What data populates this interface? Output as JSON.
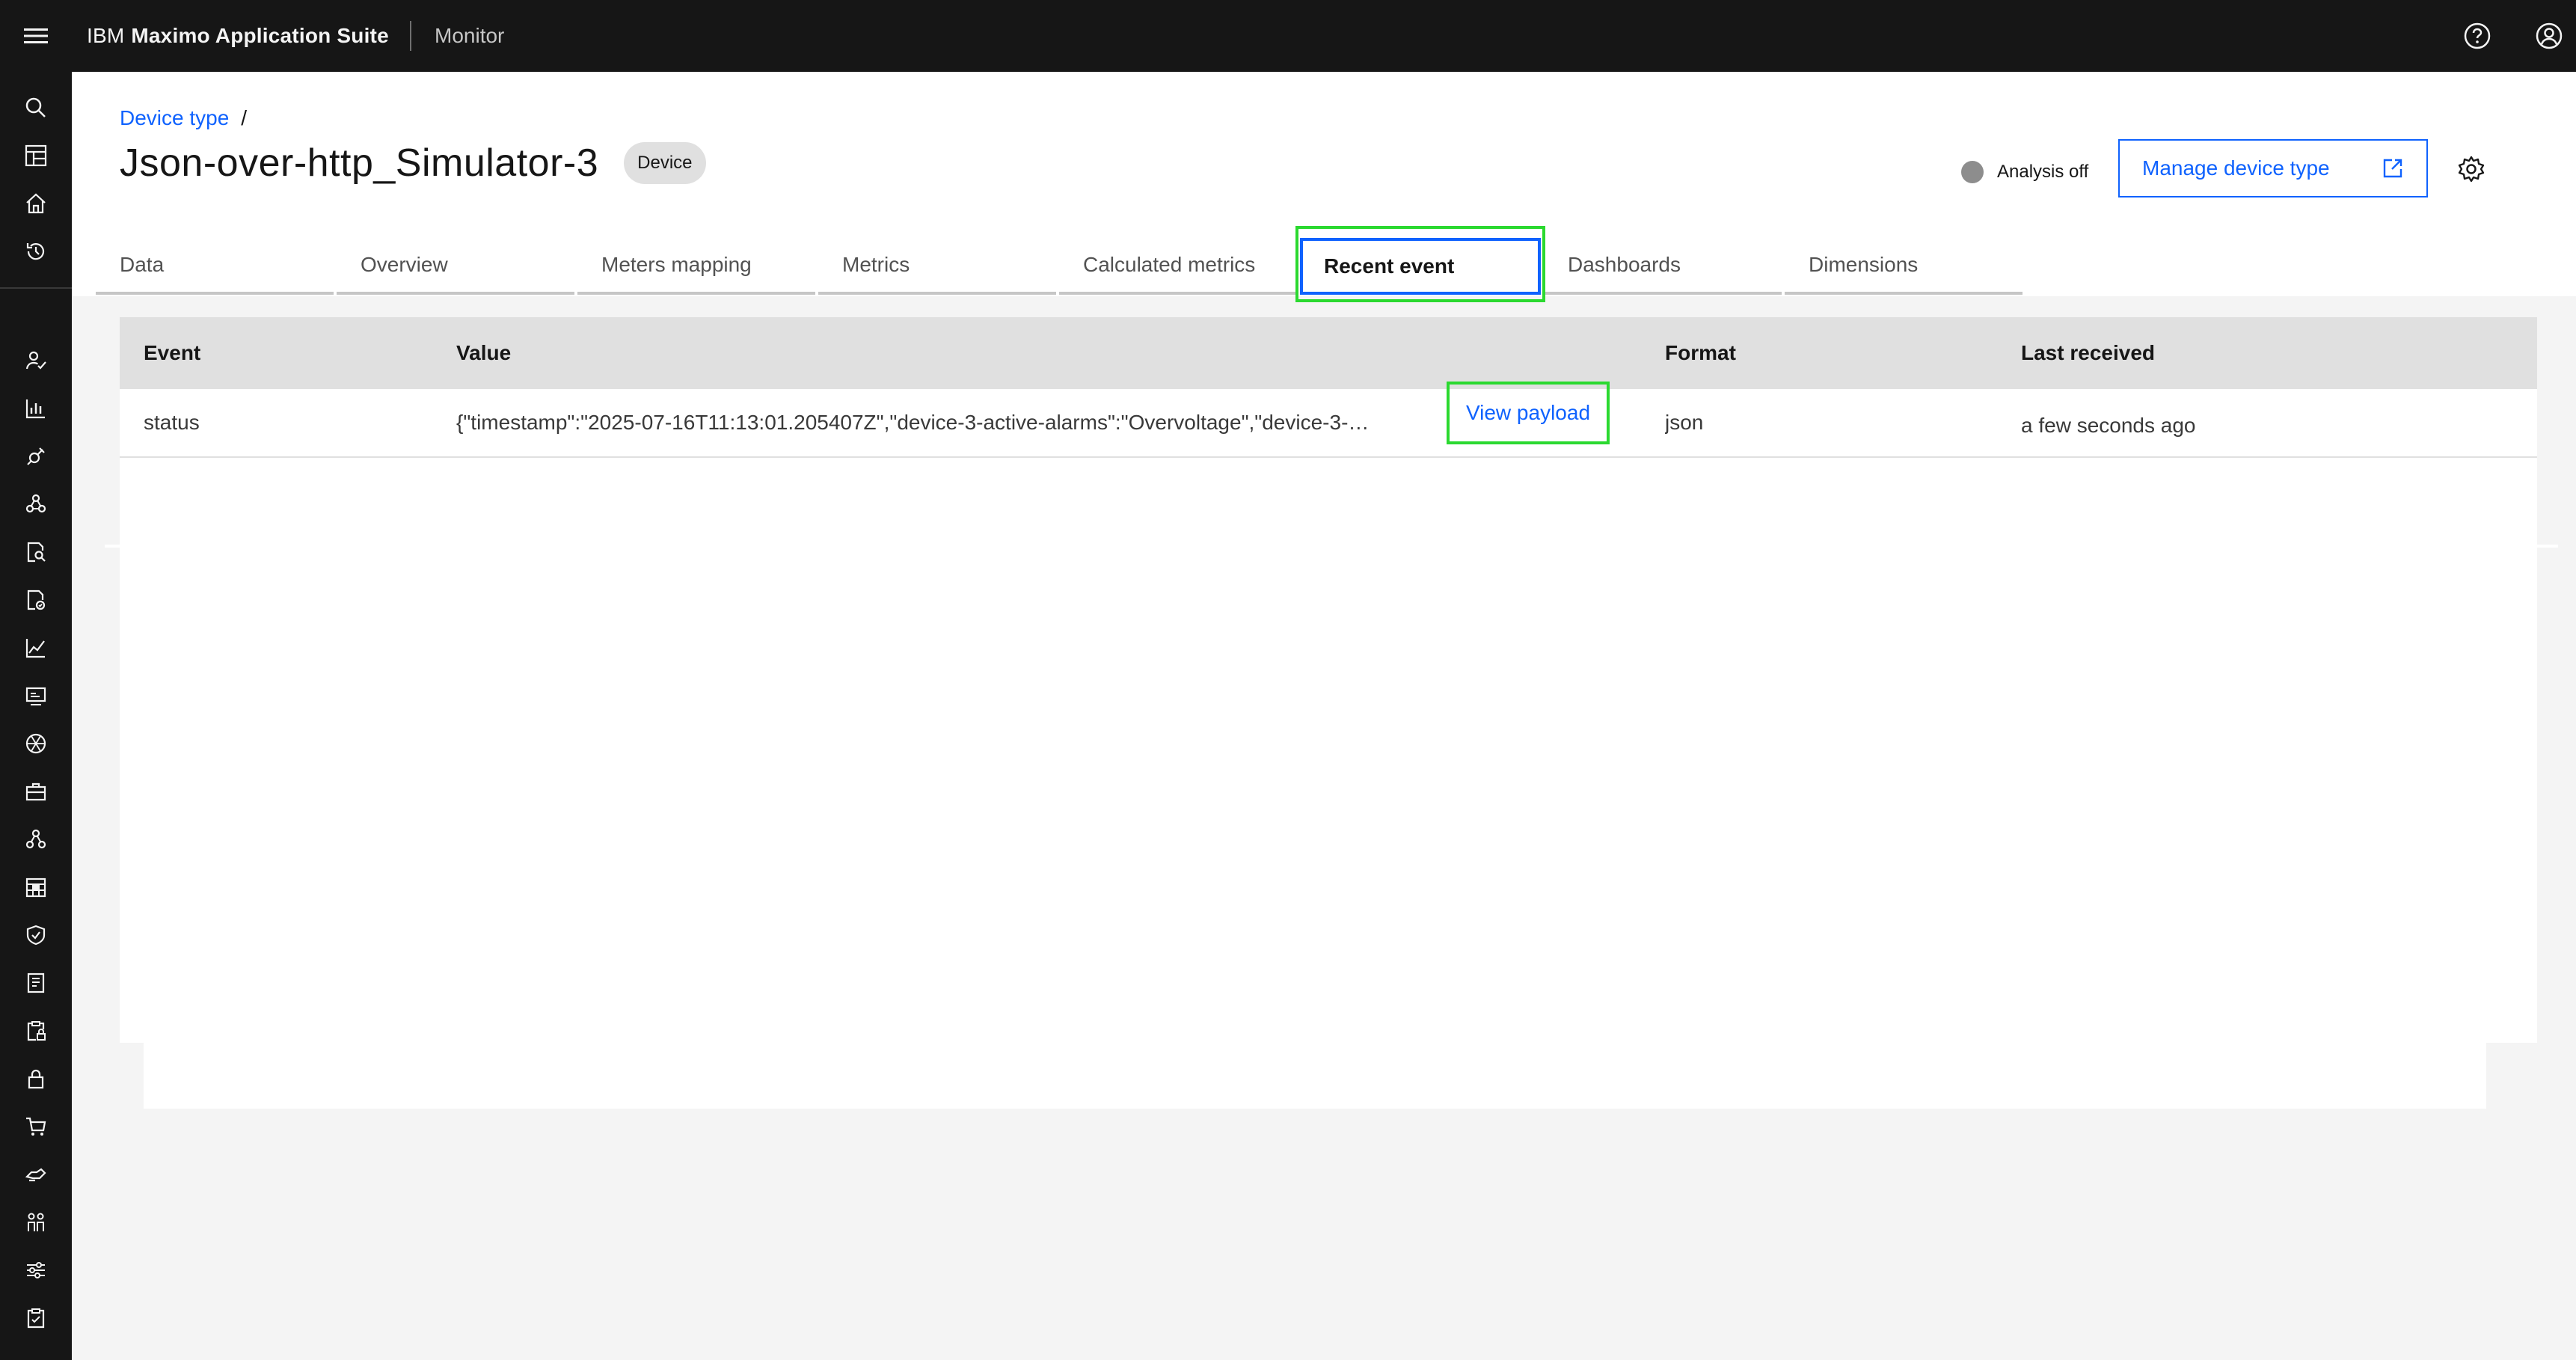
{
  "topbar": {
    "brand_prefix": "IBM",
    "brand_name": "Maximo Application Suite",
    "app_name": "Monitor",
    "icons": [
      "menu-icon",
      "help-icon",
      "user-avatar-icon"
    ]
  },
  "sidenav": {
    "icons": [
      "search-icon",
      "dashboard-icon",
      "home-icon",
      "history-icon",
      "user-check-icon",
      "bar-chart-icon",
      "satellite-icon",
      "network-icon",
      "document-search-icon",
      "document-tasks-icon",
      "line-chart-icon",
      "monitor-icon",
      "aperture-icon",
      "toolbox-icon",
      "flow-icon",
      "calendar-grid-icon",
      "shield-check-icon",
      "report-icon",
      "clipboard-lock-icon",
      "lock-icon",
      "cart-icon",
      "delivery-icon",
      "people-icon",
      "settings-adjust-icon",
      "checklist-icon"
    ]
  },
  "breadcrumb": {
    "link": "Device type",
    "separator": "/"
  },
  "page": {
    "title": "Json-over-http_Simulator-3",
    "tag": "Device"
  },
  "analysis": {
    "label": "Analysis off",
    "state_color": "#8d8d8d"
  },
  "actions": {
    "manage_label": "Manage device type"
  },
  "tabs": [
    {
      "label": "Data",
      "active": false
    },
    {
      "label": "Overview",
      "active": false
    },
    {
      "label": "Meters mapping",
      "active": false
    },
    {
      "label": "Metrics",
      "active": false
    },
    {
      "label": "Calculated metrics",
      "active": false
    },
    {
      "label": "Recent event",
      "active": true
    },
    {
      "label": "Dashboards",
      "active": false
    },
    {
      "label": "Dimensions",
      "active": false
    }
  ],
  "table": {
    "headers": [
      "Event",
      "Value",
      "Format",
      "Last received"
    ],
    "rows": [
      {
        "event": "status",
        "value": "{\"timestamp\":\"2025-07-16T11:13:01.205407Z\",\"device-3-active-alarms\":\"Overvoltage\",\"device-3-…",
        "action": "View payload",
        "format": "json",
        "last_received": "a few seconds ago"
      }
    ]
  },
  "colors": {
    "accent": "#0f62fe",
    "highlight": "#2bd930",
    "topbar": "#161616"
  }
}
